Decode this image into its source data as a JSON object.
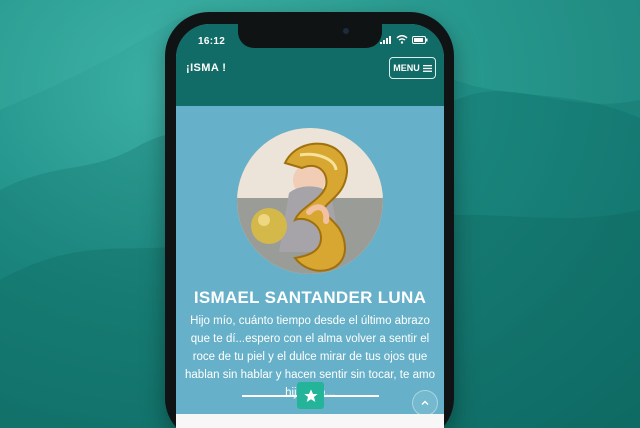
{
  "statusbar": {
    "time": "16:12"
  },
  "navbar": {
    "brand": "¡ISMA !",
    "menu_label": "MENU"
  },
  "hero": {
    "name": "ISMAEL SANTANDER LUNA",
    "description": "Hijo mío, cuánto tiempo desde el último abrazo que te dí...espero con el alma volver a sentir el roce de tu piel y el dulce mirar de tus ojos que hablan sin hablar y hacen sentir sin tocar, te amo hijo mío..."
  },
  "icons": {
    "menu": "hamburger-icon",
    "star": "star-icon",
    "scroll": "chevron-up-icon"
  }
}
